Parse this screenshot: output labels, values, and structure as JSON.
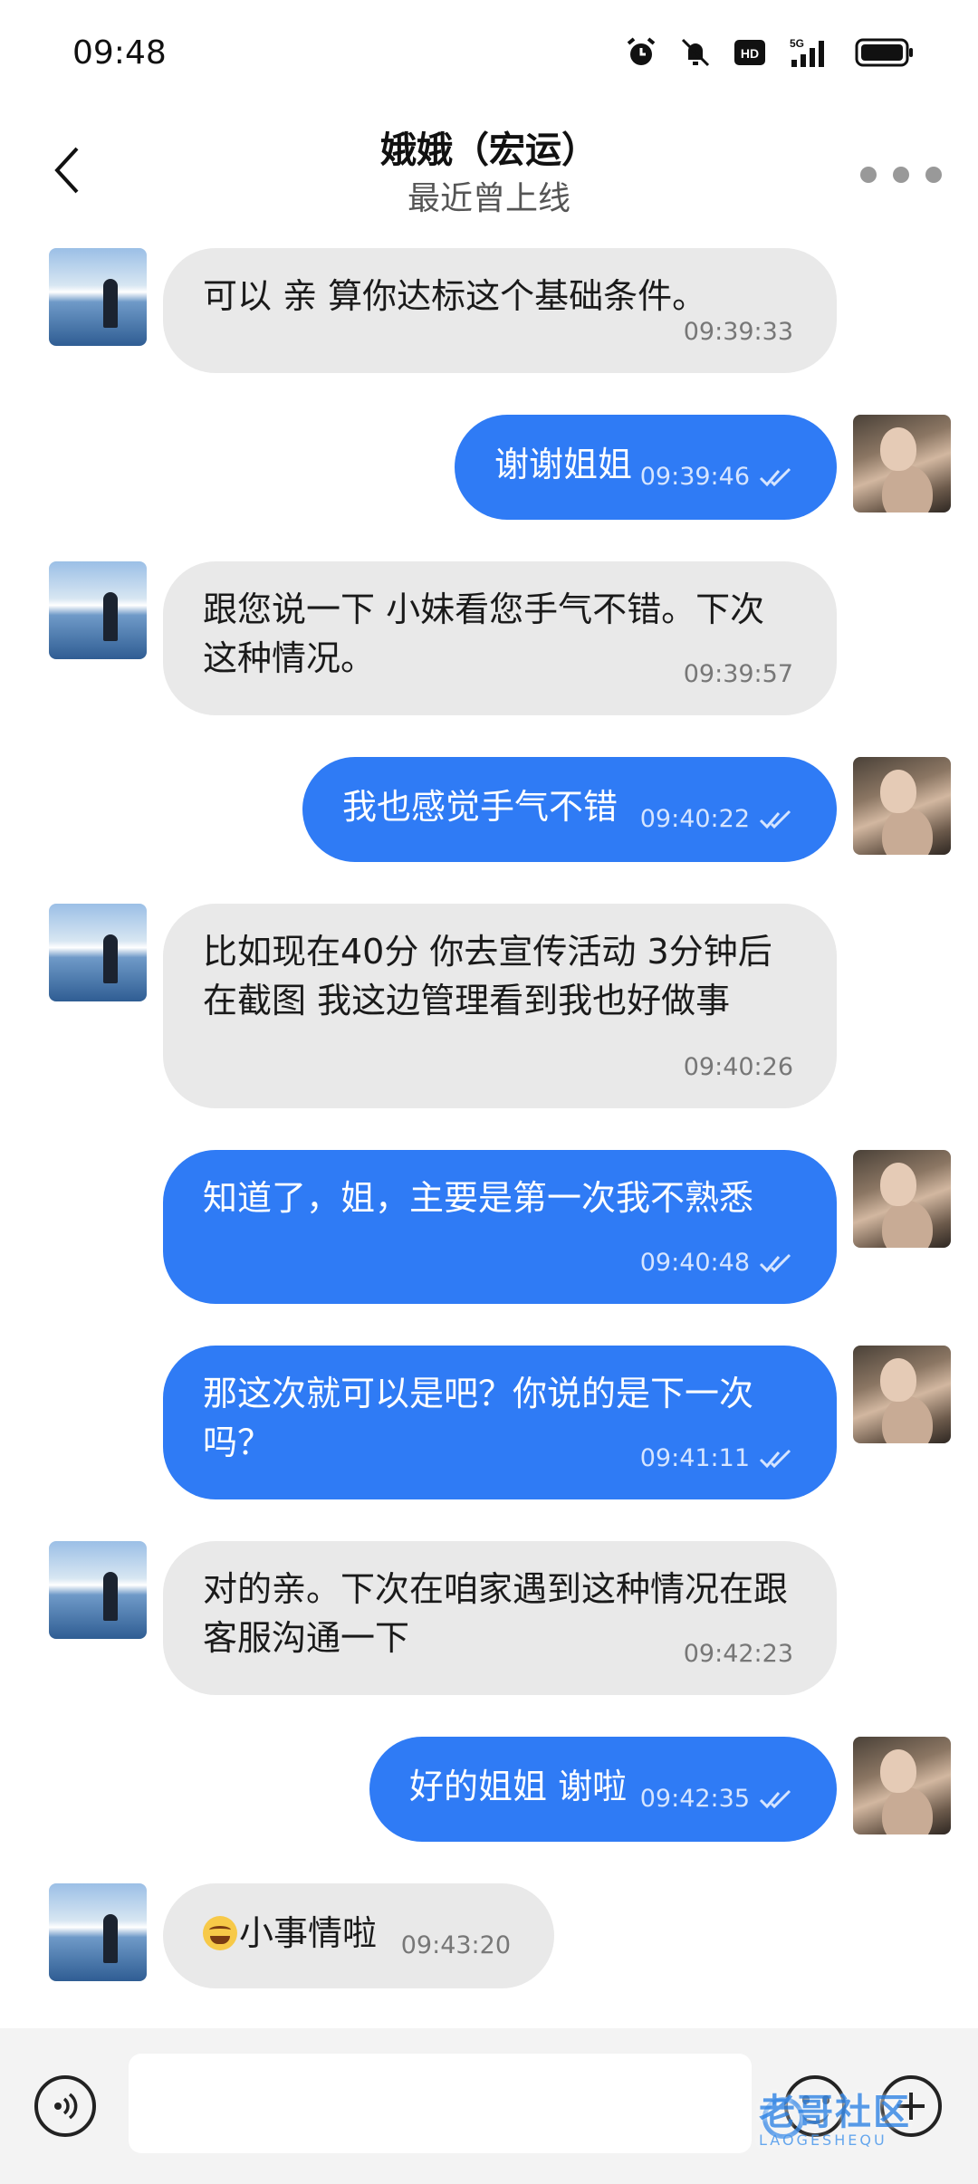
{
  "status_bar": {
    "time": "09:48",
    "icons": [
      "alarm-icon",
      "mute-icon",
      "hd-icon",
      "5g-signal-icon",
      "battery-icon"
    ],
    "hd_label": "HD",
    "network_label": "5G"
  },
  "header": {
    "title": "娥娥（宏运）",
    "subtitle": "最近曾上线",
    "back_icon": "chevron-left-icon",
    "more_icon": "more-dots-icon"
  },
  "colors": {
    "outgoing_bubble": "#2f7bf5",
    "incoming_bubble": "#e9e9e9",
    "input_bar_bg": "#f3f3f3"
  },
  "messages": [
    {
      "direction": "in",
      "text": "可以 亲 算你达标这个基础条件。",
      "time": "09:39:33"
    },
    {
      "direction": "out",
      "text": "谢谢姐姐",
      "time": "09:39:46",
      "read_icon": "double-check-icon"
    },
    {
      "direction": "in",
      "text": "跟您说一下 小妹看您手气不错。下次这种情况。",
      "time": "09:39:57"
    },
    {
      "direction": "out",
      "text": "我也感觉手气不错",
      "time": "09:40:22",
      "read_icon": "double-check-icon"
    },
    {
      "direction": "in",
      "text": "比如现在40分 你去宣传活动 3分钟后在截图 我这边管理看到我也好做事",
      "time": "09:40:26"
    },
    {
      "direction": "out",
      "text": "知道了，姐，主要是第一次我不熟悉",
      "time": "09:40:48",
      "read_icon": "double-check-icon"
    },
    {
      "direction": "out",
      "text": "那这次就可以是吧？你说的是下一次吗？",
      "time": "09:41:11",
      "read_icon": "double-check-icon"
    },
    {
      "direction": "in",
      "text": "对的亲。下次在咱家遇到这种情况在跟客服沟通一下",
      "time": "09:42:23"
    },
    {
      "direction": "out",
      "text": "好的姐姐 谢啦",
      "time": "09:42:35",
      "read_icon": "double-check-icon"
    },
    {
      "direction": "in",
      "text": "小事情啦",
      "time": "09:43:20",
      "emoji": "laughing-tears-emoji"
    }
  ],
  "input_bar": {
    "placeholder": "",
    "voice_icon": "voice-icon",
    "emoji_icon": "smiley-icon",
    "plus_icon": "plus-icon"
  },
  "watermark": {
    "text": "老哥社区",
    "subtext": "LAOGESHEQU"
  }
}
